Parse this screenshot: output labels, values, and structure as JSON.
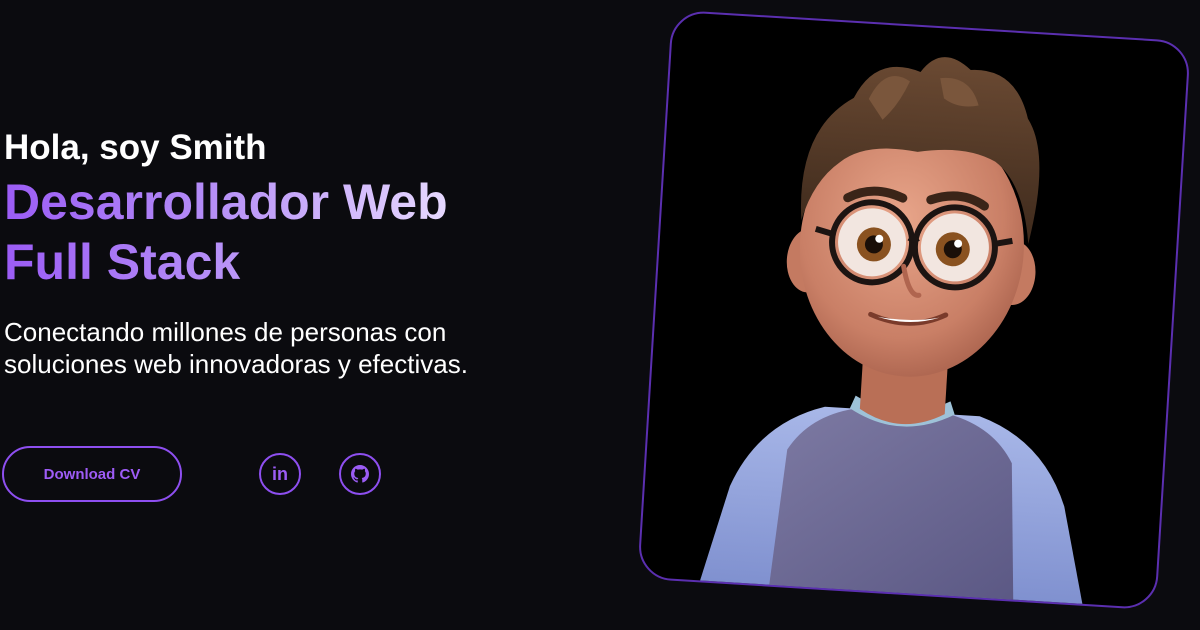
{
  "hero": {
    "greeting": "Hola, soy Smith",
    "role_line1": "Desarrollador Web",
    "role_line2": "Full Stack",
    "tagline": "Conectando millones de personas con soluciones web innovadoras y efectivas."
  },
  "actions": {
    "download_cv_label": "Download CV",
    "social": [
      {
        "icon": "linkedin-icon",
        "label": "in"
      },
      {
        "icon": "github-icon"
      }
    ]
  },
  "colors": {
    "background": "#0b0b0f",
    "accent": "#8e4ff0",
    "accent_light": "#e7d9ff",
    "text": "#ffffff",
    "frame_border": "#5b2fb0"
  }
}
